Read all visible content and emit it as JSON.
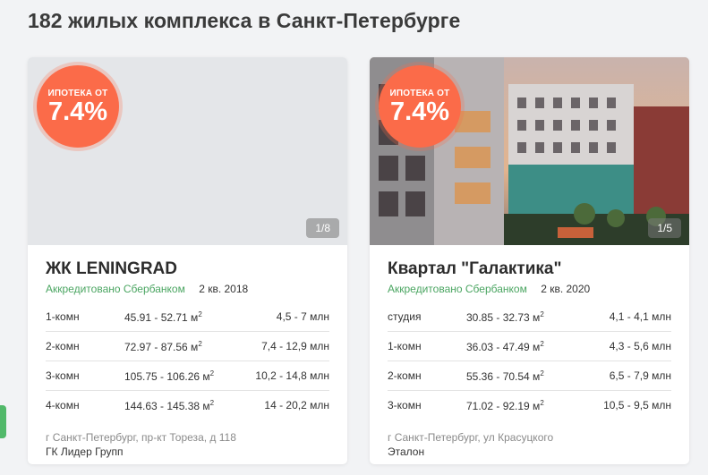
{
  "page": {
    "title": "182 жилых комплекса в Санкт-Петербурге"
  },
  "cards": [
    {
      "badge_top": "ИПОТЕКА ОТ",
      "badge_rate": "7.4%",
      "photo_counter": "1/8",
      "name": "ЖК LENINGRAD",
      "accreditation": "Аккредитовано Сбербанком",
      "completion": "2 кв. 2018",
      "units": [
        {
          "type": "1-комн",
          "area": "45.91 - 52.71 м",
          "price": "4,5 - 7 млн"
        },
        {
          "type": "2-комн",
          "area": "72.97 - 87.56 м",
          "price": "7,4 - 12,9 млн"
        },
        {
          "type": "3-комн",
          "area": "105.75 - 106.26 м",
          "price": "10,2 - 14,8 млн"
        },
        {
          "type": "4-комн",
          "area": "144.63 - 145.38 м",
          "price": "14 - 20,2 млн"
        }
      ],
      "address": "г Санкт-Петербург, пр-кт Тореза, д 118",
      "developer": "ГК Лидер Групп"
    },
    {
      "badge_top": "ИПОТЕКА ОТ",
      "badge_rate": "7.4%",
      "photo_counter": "1/5",
      "name": "Квартал \"Галактика\"",
      "accreditation": "Аккредитовано Сбербанком",
      "completion": "2 кв. 2020",
      "units": [
        {
          "type": "студия",
          "area": "30.85 - 32.73 м",
          "price": "4,1 - 4,1 млн"
        },
        {
          "type": "1-комн",
          "area": "36.03 - 47.49 м",
          "price": "4,3 - 5,6 млн"
        },
        {
          "type": "2-комн",
          "area": "55.36 - 70.54 м",
          "price": "6,5 - 7,9 млн"
        },
        {
          "type": "3-комн",
          "area": "71.02 - 92.19 м",
          "price": "10,5 - 9,5 млн"
        }
      ],
      "address": "г Санкт-Петербург, ул Красуцкого",
      "developer": "Эталон"
    }
  ],
  "area_unit_power": "2",
  "colors": {
    "badge": "#fb6b49",
    "accredited": "#4aa561",
    "side_tab": "#52b96a"
  },
  "icons": {
    "side_tab": "green-side-tab"
  }
}
